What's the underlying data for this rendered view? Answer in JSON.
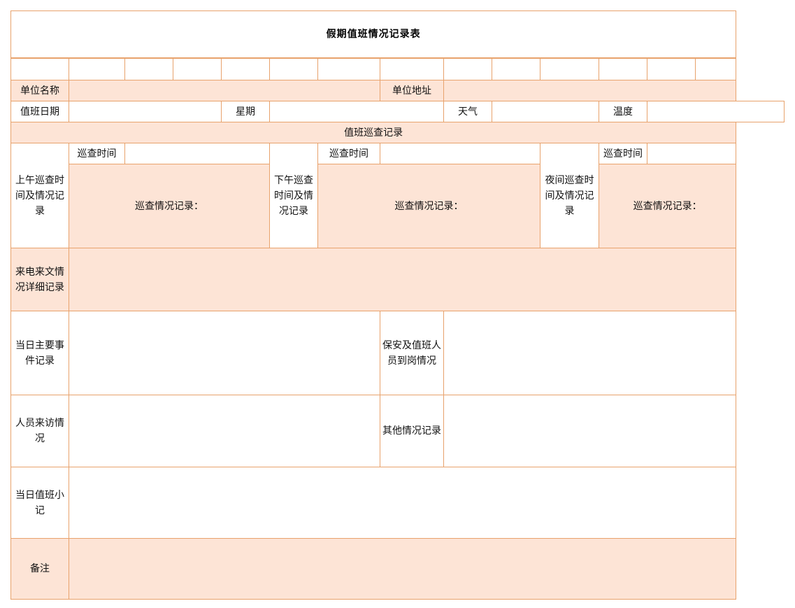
{
  "title": "假期值班情况记录表",
  "labels": {
    "unit_name": "单位名称",
    "unit_address": "单位地址",
    "duty_date": "值班日期",
    "weekday": "星期",
    "weather": "天气",
    "temperature": "温度",
    "patrol_header": "值班巡查记录",
    "patrol_time": "巡查时间",
    "patrol_notes": "巡查情况记录：",
    "morning_patrol": "上午巡查时间及情况记录",
    "afternoon_patrol": "下午巡查时间及情况记录",
    "night_patrol": "夜间巡查时间及情况记录",
    "calls_docs": "来电来文情况详细记录",
    "main_events": "当日主要事件记录",
    "security_attendance": "保安及值班人员到岗情况",
    "visitors": "人员来访情况",
    "other_situation": "其他情况记录",
    "duty_notes": "当日值班小记",
    "remarks": "备注"
  },
  "colors": {
    "border": "#e8a26c",
    "fill": "#fde4d6",
    "title_text": "#000000"
  }
}
